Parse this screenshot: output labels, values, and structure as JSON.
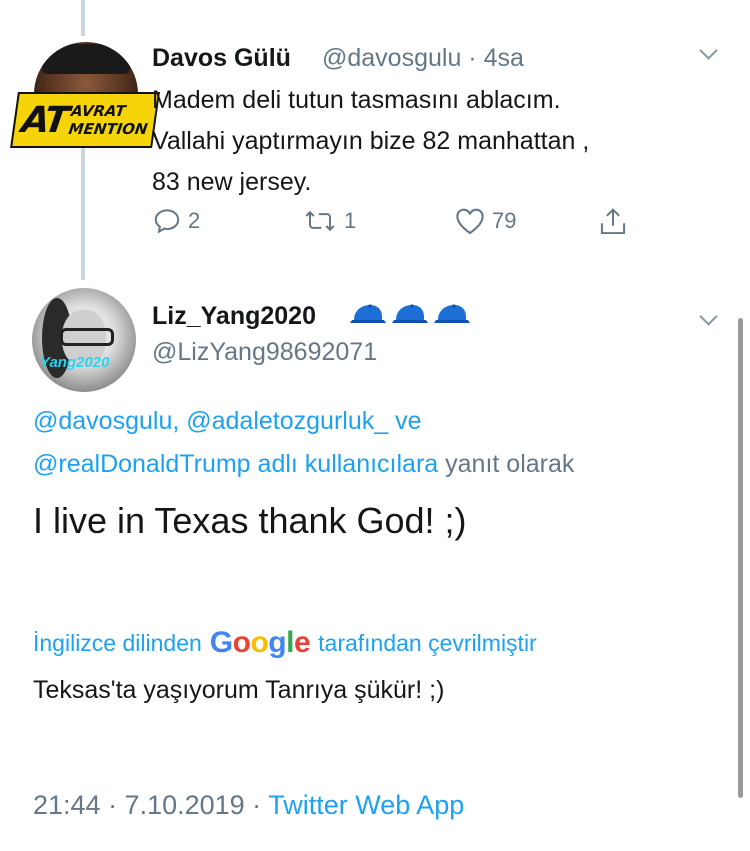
{
  "tweet1": {
    "name": "Davos Gülü",
    "handle_time": "@davosgulu · 4sa",
    "text": "Madem deli tutun tasmasını ablacım.\nVallahi yaptırmayın bize 82 manhattan ,\n83 new jersey.",
    "badge": {
      "big": "AT",
      "top": "AVRAT",
      "bottom": "MENTION"
    },
    "actions": {
      "replies": "2",
      "retweets": "1",
      "likes": "79"
    }
  },
  "tweet2": {
    "name": "Liz_Yang2020",
    "name_emoji": [
      "cap-icon",
      "cap-icon",
      "cap-icon"
    ],
    "handle": "@LizYang98692071",
    "avatar_text": "Yang2020",
    "replying_links_1": "@davosgulu, @adaletozgurluk_ ve",
    "replying_links_2": "@realDonaldTrump adlı kullanıcılara",
    "replying_suffix": "yanıt olarak",
    "text": "I live in Texas thank God! ;)",
    "translated_prefix": "İngilizce dilinden",
    "translated_brand": "Google",
    "translated_suffix": "tarafından çevrilmiştir",
    "translation": "Teksas'ta yaşıyorum Tanrıya şükür! ;)",
    "timestamp": "21:44 · 7.10.2019 ·",
    "source": "Twitter Web App"
  },
  "colors": {
    "link": "#1da1f2",
    "secondary": "#657786",
    "cap": "#1d6fd6"
  }
}
